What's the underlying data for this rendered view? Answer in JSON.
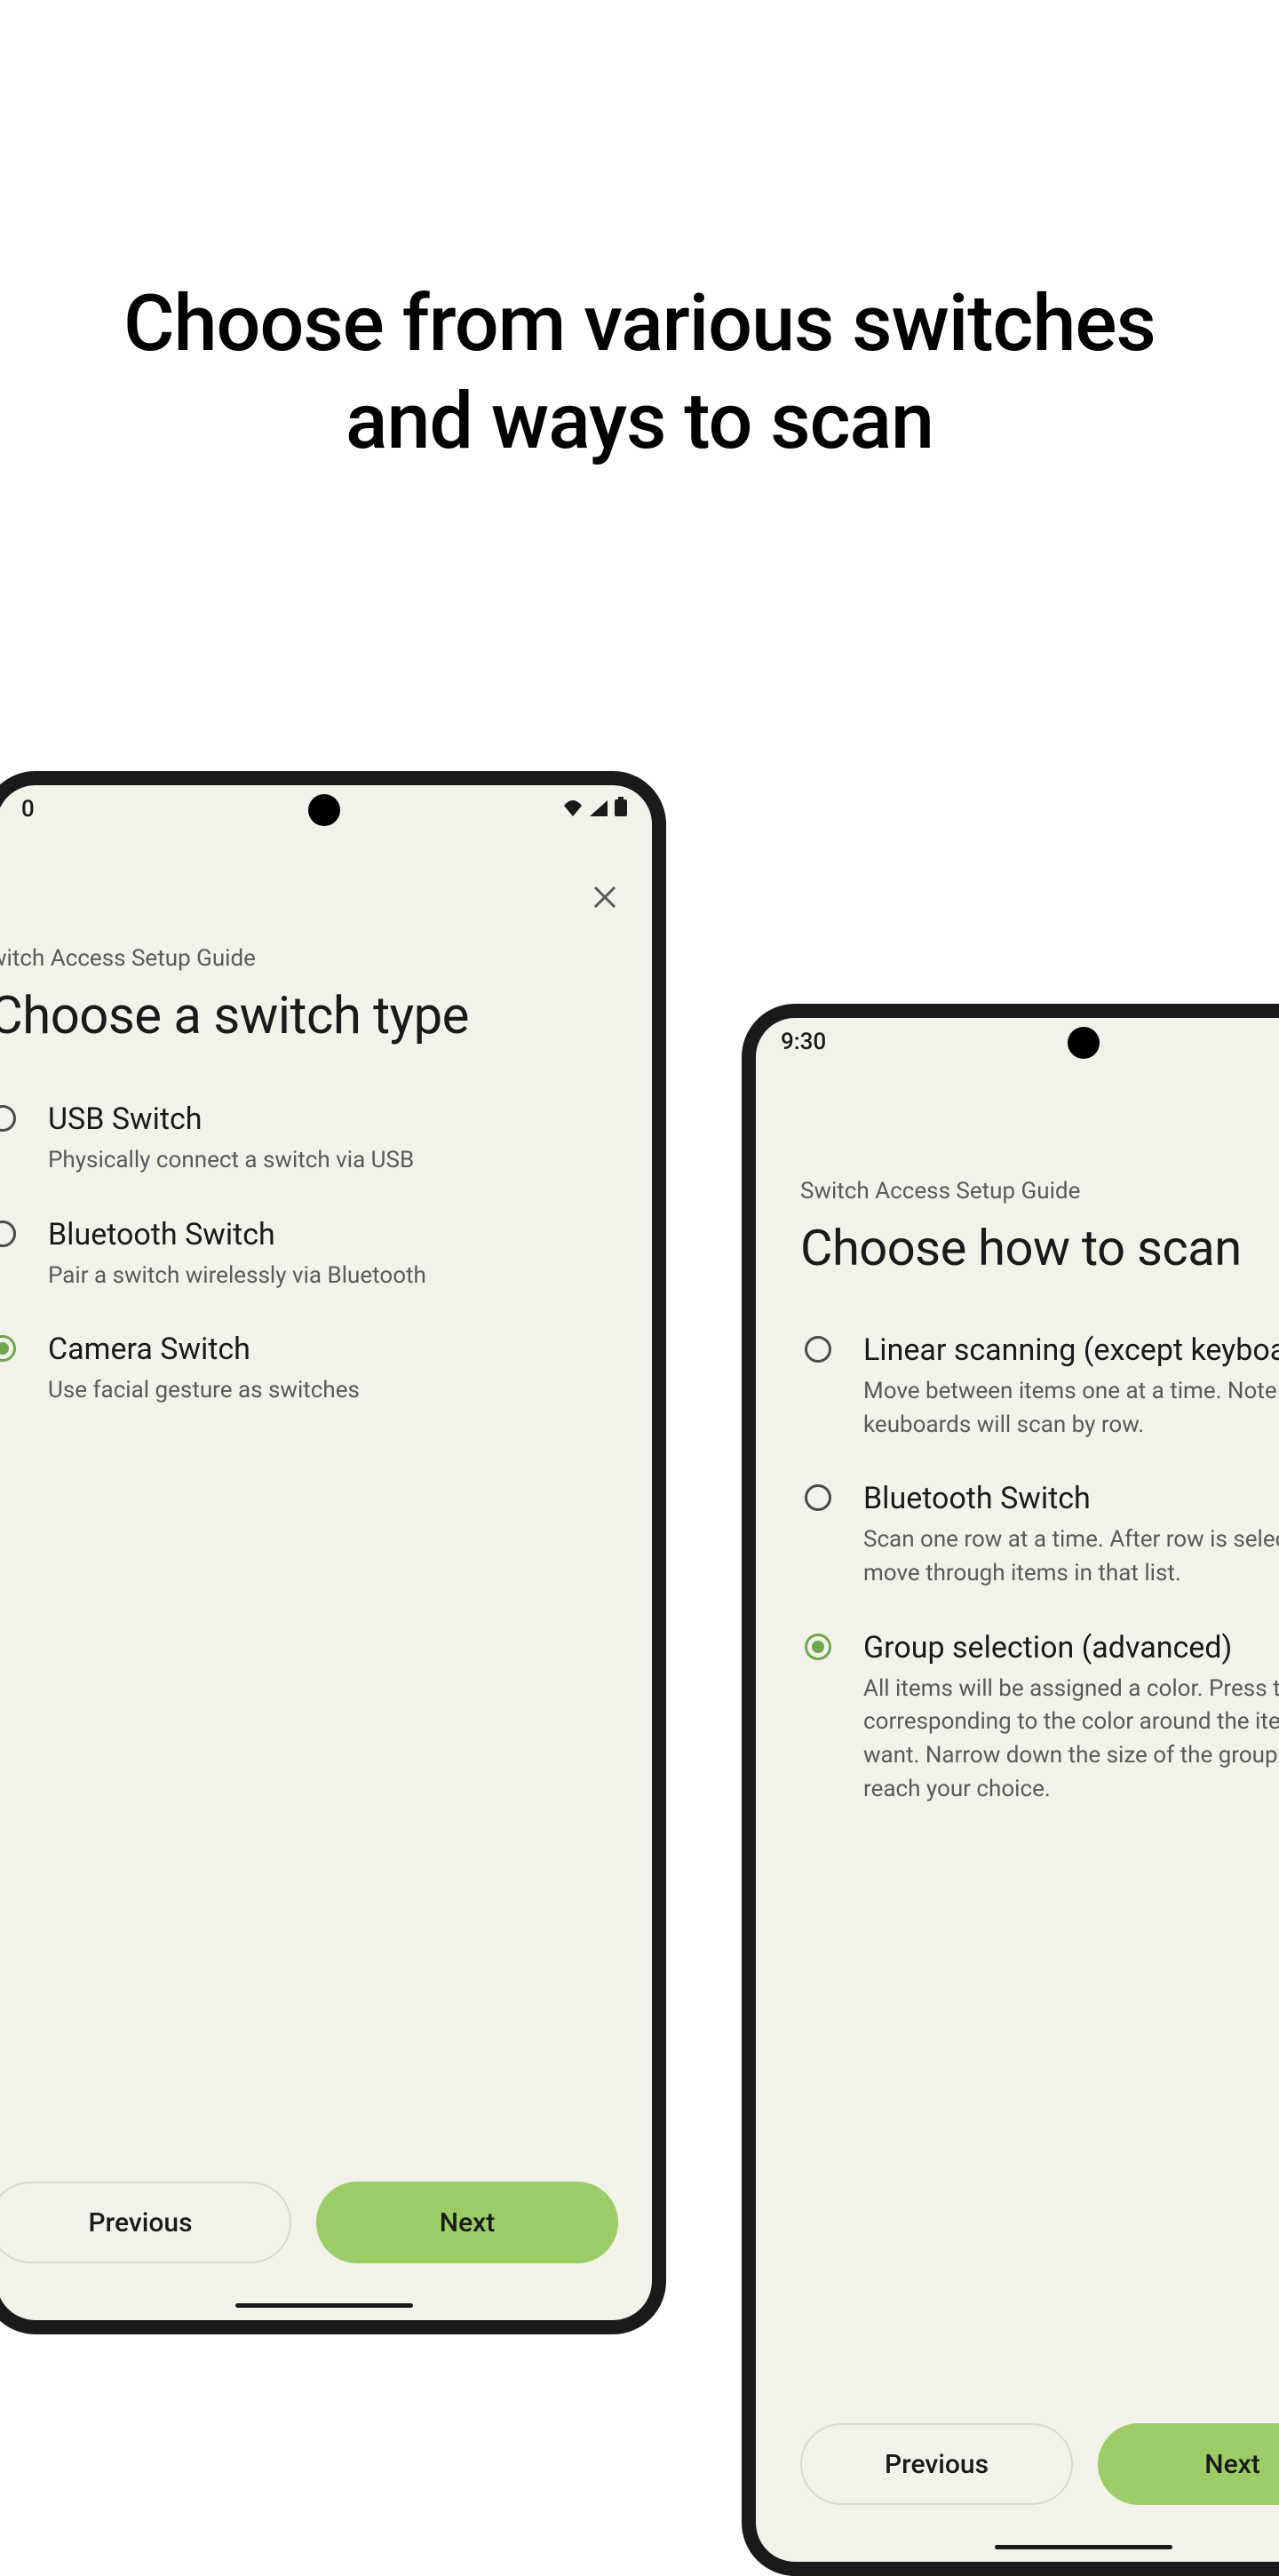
{
  "headline": "Choose from various switches\nand ways to scan",
  "phones": {
    "left": {
      "time": "0",
      "guide": "witch Access Setup Guide",
      "title": "Choose a switch type",
      "options": [
        {
          "title": "USB Switch",
          "desc": "Physically connect a switch via USB",
          "selected": false
        },
        {
          "title": "Bluetooth Switch",
          "desc": "Pair a switch wirelessly via Bluetooth",
          "selected": false
        },
        {
          "title": "Camera Switch",
          "desc": "Use facial gesture as switches",
          "selected": true
        }
      ],
      "prev": "Previous",
      "next": "Next"
    },
    "right": {
      "time": "9:30",
      "guide": "Switch Access Setup Guide",
      "title": "Choose how to scan",
      "options": [
        {
          "title": "Linear scanning (except keyboa",
          "desc": "Move between items one at a time. Note that keuboards will scan by row.",
          "selected": false
        },
        {
          "title": "Bluetooth Switch",
          "desc": "Scan one row at a time. After row is selected, move through items in that list.",
          "selected": false
        },
        {
          "title": "Group selection (advanced)",
          "desc": "All items will be assigned a color. Press the switch corresponding to the color around the item you want. Narrow down the size of the group until you reach your choice.",
          "selected": true
        }
      ],
      "prev": "Previous",
      "next": "Next"
    }
  }
}
